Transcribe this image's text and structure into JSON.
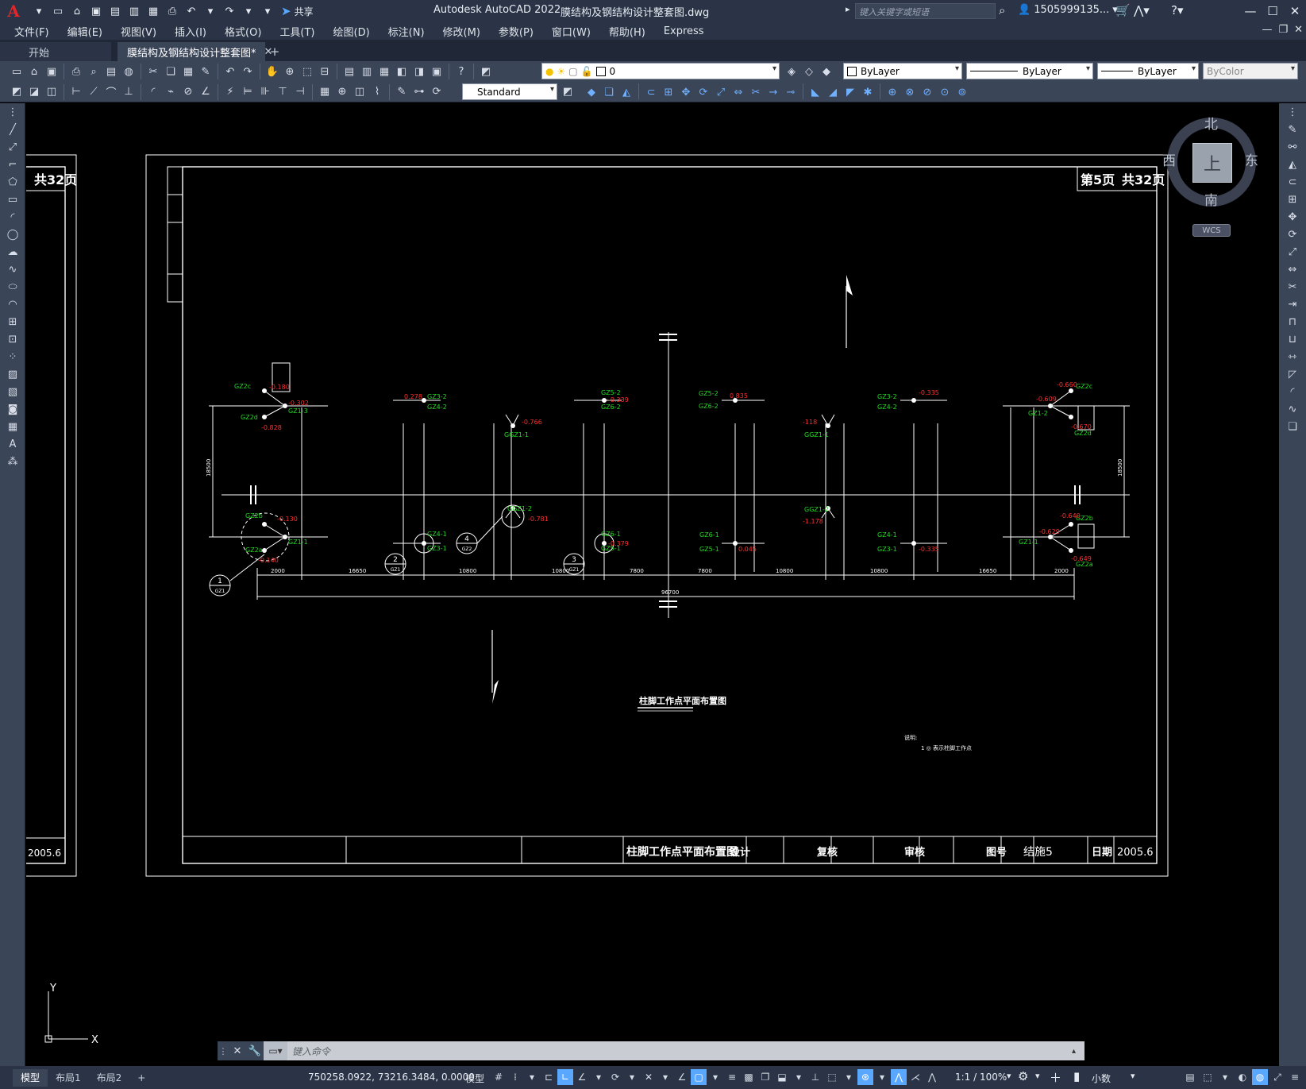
{
  "app": {
    "title": "Autodesk AutoCAD 2022",
    "filename": "膜结构及钢结构设计整套图.dwg",
    "share_label": "共享",
    "search_placeholder": "键入关键字或短语",
    "user": "1505999135..."
  },
  "menu": [
    "文件(F)",
    "编辑(E)",
    "视图(V)",
    "插入(I)",
    "格式(O)",
    "工具(T)",
    "绘图(D)",
    "标注(N)",
    "修改(M)",
    "参数(P)",
    "窗口(W)",
    "帮助(H)",
    "Express"
  ],
  "tabs": {
    "start": "开始",
    "active": "膜结构及钢结构设计整套图*"
  },
  "toolbar": {
    "layer_value": "0",
    "color_value": "ByLayer",
    "linetype_value": "ByLayer",
    "lineweight_value": "ByLayer",
    "plotstyle_value": "ByColor",
    "textstyle_value": "Standard"
  },
  "viewcube": {
    "north": "北",
    "south": "南",
    "east": "东",
    "west": "西",
    "face": "上",
    "wcs": "WCS"
  },
  "drawing": {
    "left_sheet": {
      "total": "共32页",
      "date": "2005.6"
    },
    "main_sheet": {
      "page": "第5页",
      "total": "共32页",
      "titleblock": {
        "name": "柱脚工作点平面布置图",
        "design": "设计",
        "check": "复核",
        "review": "审核",
        "drawing_no_label": "图号",
        "drawing_no": "结施5",
        "date_label": "日期",
        "date": "2005.6"
      },
      "plan_title": "柱脚工作点平面布置图",
      "note_label": "说明:",
      "note_text": "1  ◎  表示柱脚工作点"
    },
    "dimensions": {
      "bottom": [
        "2000",
        "16650",
        "10800",
        "10800",
        "7800",
        "7800",
        "10800",
        "10800",
        "16650",
        "2000"
      ],
      "total": "96700",
      "side": "18500"
    },
    "labels_green": [
      "GZ2c",
      "GZ2d",
      "GZ1-3",
      "GZ3-2",
      "GZ4-2",
      "GGZ1-1",
      "GZ5-2",
      "GZ6-2",
      "GZ5-2",
      "GZ6-2",
      "GGZ1-1",
      "GZ3-2",
      "GZ4-2",
      "GZ2c",
      "GZ1-2",
      "GZ2d",
      "GZ2b",
      "GZ2a",
      "GZ1-1",
      "GZ4-1",
      "GZ3-1",
      "GGZ1-2",
      "GZ6-1",
      "GZ5-1",
      "GZ6-1",
      "GZ5-1",
      "GGZ1-2",
      "GZ4-1",
      "GZ3-1",
      "GZ2b",
      "GZ2a",
      "GZ1-1"
    ],
    "labels_red": [
      "-0.180",
      "-0.302",
      "-0.828",
      "0.278",
      "-0.766",
      "-0.339",
      "0.835",
      "-118",
      "-0.335",
      "-0.660",
      "-0.609",
      "-0.670",
      "-0.130",
      "-0.140",
      "-0.781",
      "-0.379",
      "-1.178",
      "0.045",
      "-0.335",
      "-0.640",
      "-0.629",
      "-0.649"
    ],
    "callouts": [
      "1",
      "2",
      "3",
      "4"
    ],
    "callout_sub": [
      "GZ1",
      "GZ1",
      "GZ1",
      "GZ2"
    ]
  },
  "command": {
    "placeholder": "键入命令"
  },
  "status": {
    "tabs": [
      "模型",
      "布局1",
      "布局2"
    ],
    "coords": "750258.0922, 73216.3484, 0.0000",
    "model": "模型",
    "scale": "1:1 / 100%",
    "units": "小数"
  }
}
